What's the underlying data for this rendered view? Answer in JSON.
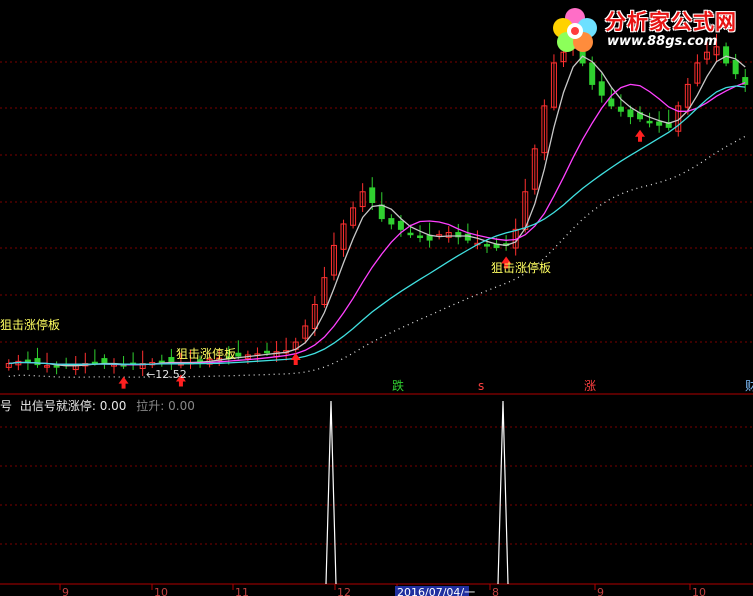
{
  "logo": {
    "title": "分析家公式网",
    "url": "www.88gs.com"
  },
  "main_panel": {
    "labels": {
      "snipe_1": "狙击涨停板",
      "snipe_2": "狙击涨停板",
      "snipe_3": "狙击涨停板",
      "low_price": "12.52"
    },
    "markers": {
      "die": "跌",
      "s": "s",
      "zhang": "涨",
      "right_edge": "财"
    }
  },
  "sub_panel": {
    "left_char": "号",
    "indicator_name": "出信号就涨停:",
    "indicator_value": "0.00",
    "second_name": "拉升:",
    "second_value": "0.00"
  },
  "x_axis": {
    "ticks": [
      "9",
      "10",
      "11",
      "12",
      "2016/07/04/一",
      "8",
      "9",
      "10"
    ]
  },
  "colors": {
    "up": "#ff3030",
    "down": "#30d030",
    "ma_white": "#c8c8c8",
    "ma_magenta": "#ff40ff",
    "ma_cyan": "#40e0e0",
    "grid": "#7a0000",
    "axis": "#b00000",
    "label_yellow": "#ffff60",
    "spike": "#ffffff"
  },
  "chart_data": {
    "type": "candlestick",
    "note_series": [
      "close"
    ],
    "close": [
      40,
      42,
      41,
      39,
      38,
      37,
      38,
      39,
      40,
      41,
      40,
      39,
      38,
      39,
      40,
      41,
      42,
      41,
      40,
      41,
      43,
      44,
      45,
      46,
      47,
      48,
      49,
      50,
      51,
      52,
      60,
      75,
      95,
      120,
      150,
      170,
      185,
      200,
      190,
      175,
      170,
      165,
      160,
      158,
      155,
      160,
      162,
      158,
      155,
      152,
      150,
      148,
      150,
      165,
      200,
      240,
      280,
      320,
      330,
      335,
      320,
      300,
      290,
      280,
      275,
      270,
      268,
      265,
      262,
      260,
      280,
      300,
      320,
      330,
      335,
      320,
      310,
      300
    ],
    "signals": [
      {
        "index": 18,
        "label": "狙击涨停板"
      },
      {
        "index": 54,
        "label": "狙击涨停板"
      }
    ],
    "sub_series": [
      {
        "name": "出信号就涨停",
        "spikes_at": [
          "12",
          "8"
        ]
      }
    ]
  }
}
